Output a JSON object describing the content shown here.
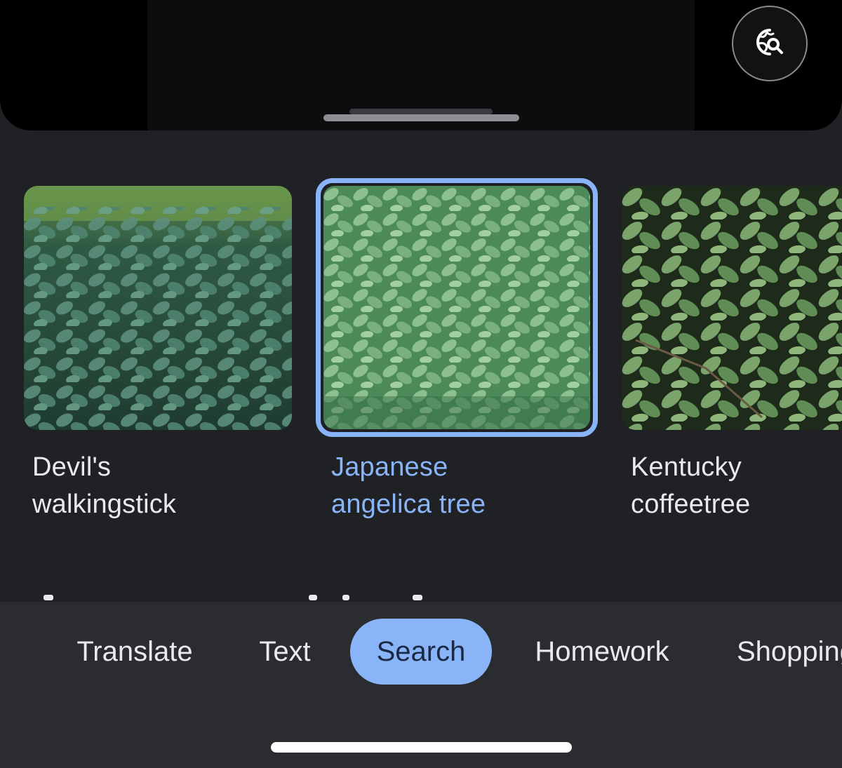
{
  "top_preview": {
    "lens_button_icon": "lens-search-icon"
  },
  "results": [
    {
      "line1": "Devil's",
      "line2": "walkingstick",
      "selected": false
    },
    {
      "line1": "Japanese",
      "line2": "angelica tree",
      "selected": true
    },
    {
      "line1": "Kentucky",
      "line2": "coffeetree",
      "selected": false
    }
  ],
  "mode_bar": {
    "tabs": [
      {
        "label": "Translate",
        "active": false
      },
      {
        "label": "Text",
        "active": false
      },
      {
        "label": "Search",
        "active": true
      },
      {
        "label": "Homework",
        "active": false
      },
      {
        "label": "Shopping",
        "active": false
      }
    ]
  },
  "colors": {
    "background": "#202124",
    "accent": "#8ab4f8",
    "text": "#e8eaed",
    "mode_bar": "#2b2c30"
  }
}
